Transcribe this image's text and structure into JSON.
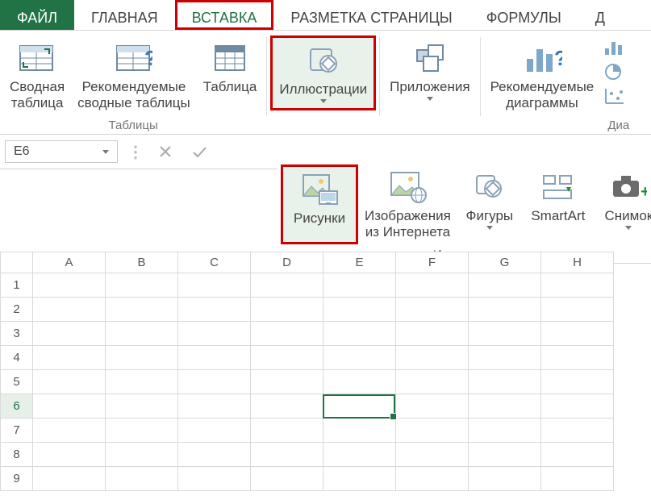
{
  "tabs": {
    "file": "ФАЙЛ",
    "home": "ГЛАВНАЯ",
    "insert": "ВСТАВКА",
    "layout": "РАЗМЕТКА СТРАНИЦЫ",
    "formulas": "ФОРМУЛЫ",
    "data_partial": "Д"
  },
  "ribbon": {
    "tables": {
      "pivot": "Сводная\nтаблица",
      "recommended": "Рекомендуемые\nсводные таблицы",
      "table": "Таблица",
      "group_label": "Таблицы"
    },
    "illustrations": {
      "btn": "Иллюстрации"
    },
    "apps": {
      "btn": "Приложения"
    },
    "charts": {
      "recommended": "Рекомендуемые\nдиаграммы",
      "group_label": "Диа"
    }
  },
  "gallery": {
    "pictures": "Рисунки",
    "online": "Изображения\nиз Интернета",
    "shapes": "Фигуры",
    "smartart": "SmartArt",
    "screenshot": "Снимок",
    "group_label": "Иллюстрации"
  },
  "formula_bar": {
    "name": "E6"
  },
  "columns": [
    "A",
    "B",
    "C",
    "D",
    "E",
    "F",
    "G",
    "H"
  ],
  "rows": [
    "1",
    "2",
    "3",
    "4",
    "5",
    "6",
    "7",
    "8",
    "9"
  ],
  "selected_row": "6"
}
